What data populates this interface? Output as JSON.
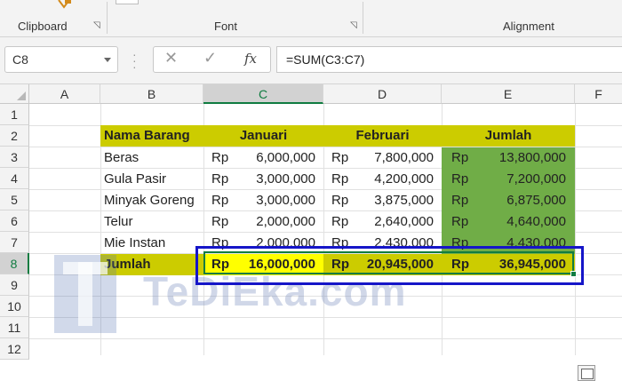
{
  "ribbon": {
    "groups": [
      {
        "label": "Clipboard"
      },
      {
        "label": "Font"
      },
      {
        "label": "Alignment"
      }
    ]
  },
  "formula_bar": {
    "name_box": "C8",
    "cancel_icon": "close-icon",
    "enter_icon": "check-icon",
    "fx_label": "fx",
    "formula": "=SUM(C3:C7)"
  },
  "columns": [
    "A",
    "B",
    "C",
    "D",
    "E",
    "F"
  ],
  "rows": [
    "1",
    "2",
    "3",
    "4",
    "5",
    "6",
    "7",
    "8",
    "9",
    "10",
    "11",
    "12"
  ],
  "selected": {
    "column": "C",
    "row": "8"
  },
  "table": {
    "headers": {
      "item": "Nama Barang",
      "jan": "Januari",
      "feb": "Februari",
      "total": "Jumlah"
    },
    "currency": "Rp",
    "rows": [
      {
        "item": "Beras",
        "jan": "6,000,000",
        "feb": "7,800,000",
        "total": "13,800,000"
      },
      {
        "item": "Gula Pasir",
        "jan": "3,000,000",
        "feb": "4,200,000",
        "total": "7,200,000"
      },
      {
        "item": "Minyak Goreng",
        "jan": "3,000,000",
        "feb": "3,875,000",
        "total": "6,875,000"
      },
      {
        "item": "Telur",
        "jan": "2,000,000",
        "feb": "2,640,000",
        "total": "4,640,000"
      },
      {
        "item": "Mie Instan",
        "jan": "2,000,000",
        "feb": "2,430,000",
        "total": "4,430,000"
      }
    ],
    "sum": {
      "label": "Jumlah",
      "jan": "16,000,000",
      "feb": "20,945,000",
      "total": "36,945,000"
    }
  },
  "watermark": "TeDiEka.com",
  "colors": {
    "header_fill": "#cccc00",
    "total_fill": "#70ad47",
    "selection": "#107c41",
    "highlight_box": "#1515c8"
  }
}
